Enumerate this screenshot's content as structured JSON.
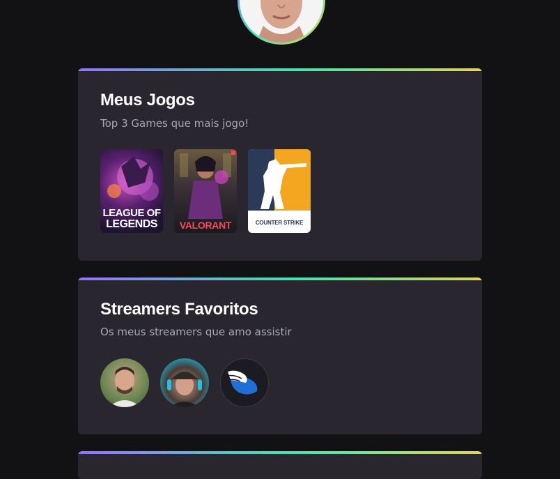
{
  "profile": {
    "avatar_icon": "user-photo"
  },
  "games_section": {
    "title": "Meus Jogos",
    "subtitle": "Top 3 Games que mais jogo!",
    "games": [
      {
        "name": "League of Legends",
        "logo_line1": "LEAGUE OF",
        "logo_line2": "LEGENDS"
      },
      {
        "name": "Valorant",
        "logo": "VALORANT"
      },
      {
        "name": "Counter-Strike",
        "logo": "COUNTER STRIKE"
      }
    ]
  },
  "streamers_section": {
    "title": "Streamers Favoritos",
    "subtitle": "Os meus streamers que amo assistir",
    "streamers": [
      {
        "icon": "streamer-avatar-1"
      },
      {
        "icon": "streamer-avatar-2"
      },
      {
        "icon": "streamer-avatar-3-wing-logo"
      }
    ]
  },
  "colors": {
    "background": "#121214",
    "card": "#29262f",
    "gradient": [
      "#9572fc",
      "#43e7ad",
      "#e2d45c"
    ],
    "title": "#ffffff",
    "subtitle": "#a8a8b3"
  }
}
